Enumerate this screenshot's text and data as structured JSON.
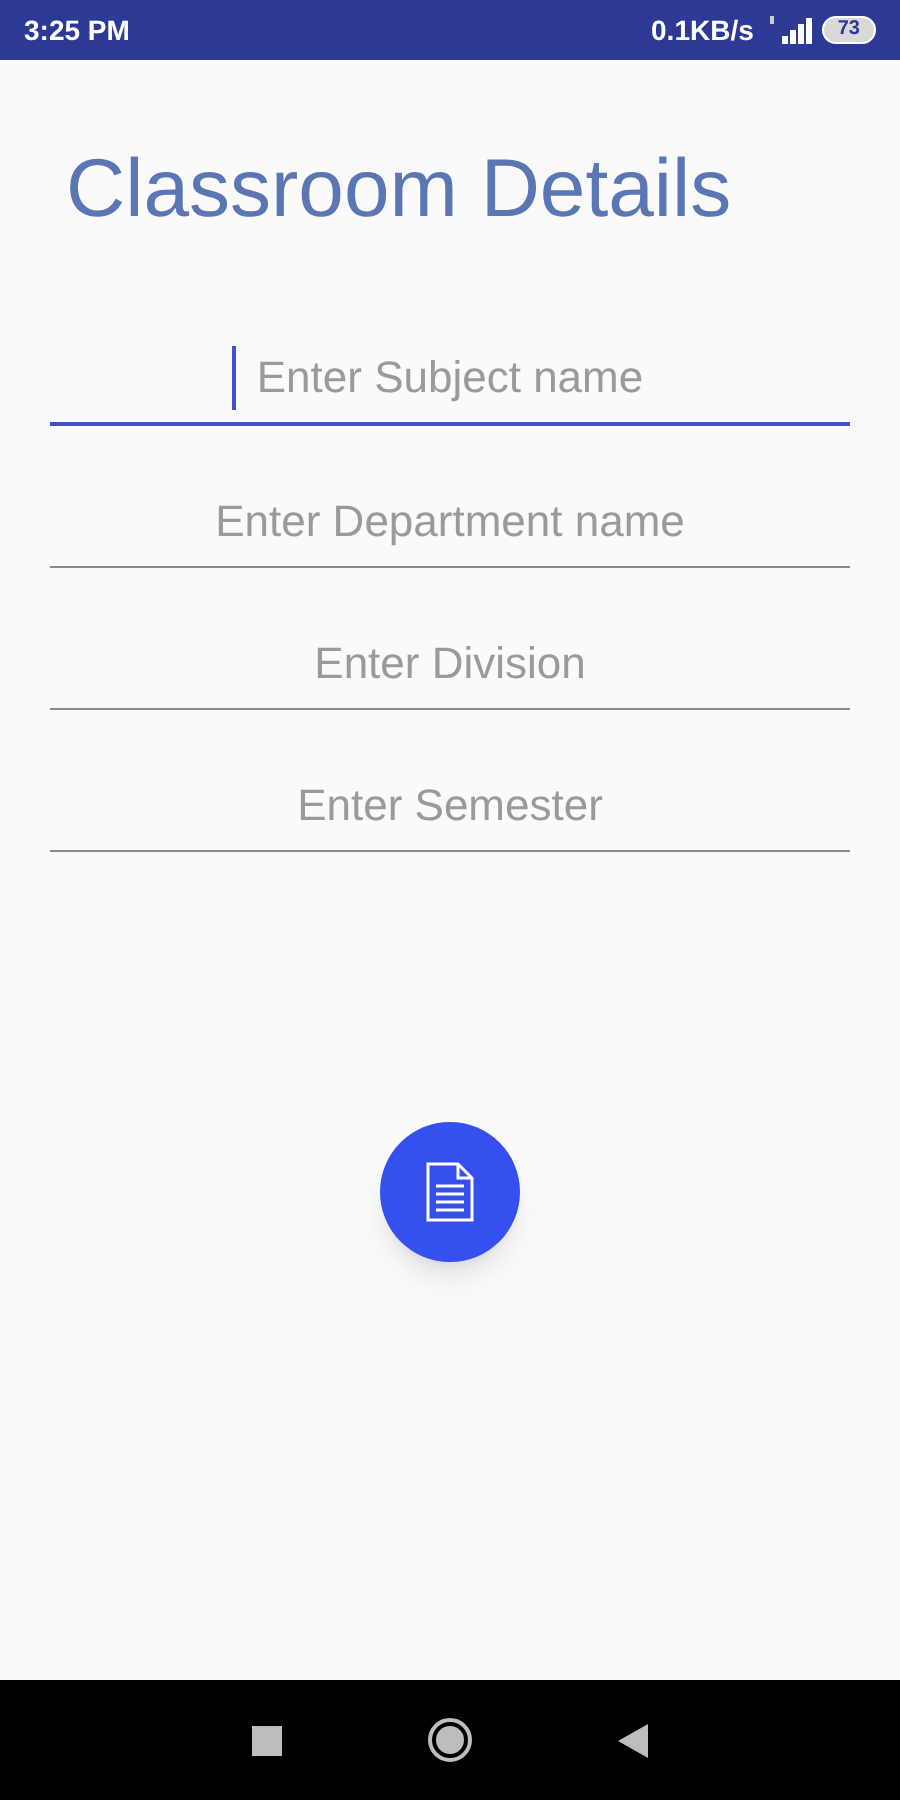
{
  "status_bar": {
    "time": "3:25 PM",
    "speed": "0.1KB/s",
    "battery": "73"
  },
  "title": "Classroom Details",
  "fields": [
    {
      "placeholder": "Enter Subject name",
      "focused": true
    },
    {
      "placeholder": "Enter Department name",
      "focused": false
    },
    {
      "placeholder": "Enter Division",
      "focused": false
    },
    {
      "placeholder": "Enter Semester",
      "focused": false
    }
  ]
}
